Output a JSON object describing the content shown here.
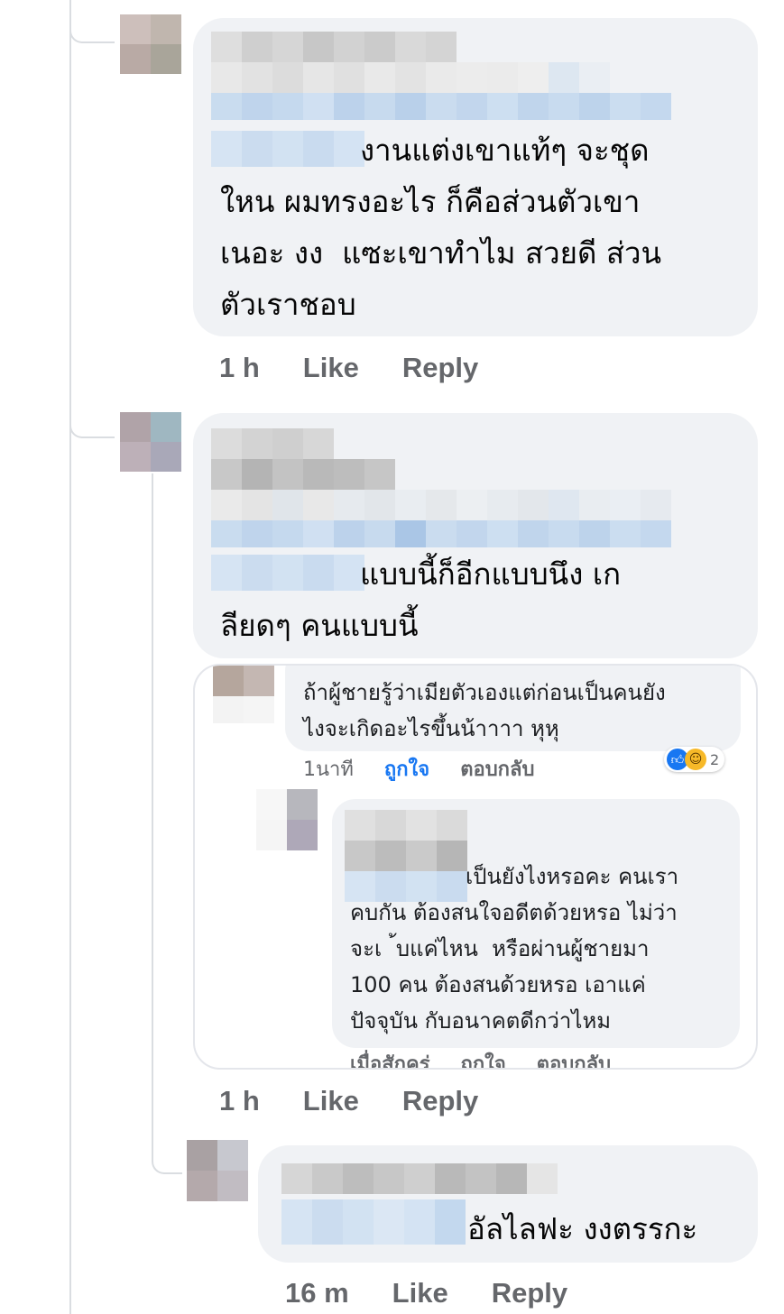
{
  "colors": {
    "bubble": "#f0f2f5",
    "meta_text": "#65676b",
    "thread_line": "#dadde1",
    "link_blue": "#1877f2",
    "blur_gray": [
      "#dcdcdc",
      "#c8c8c8",
      "#b4b4b4",
      "#d0d0d0",
      "#e6e6e6"
    ],
    "blur_blue": [
      "#c9dcef",
      "#b9d0ea",
      "#d6e4f3",
      "#aac6e6"
    ]
  },
  "comments": [
    {
      "text": "งานแต่งเขาแท้ๆ จะชุด\nใหน ผมทรงอะไร ก็คือส่วนตัวเขา\nเนอะ งง  แซะเขาทำไม สวยดี ส่วน\nตัวเราชอบ",
      "time": "1 h",
      "like": "Like",
      "reply": "Reply"
    },
    {
      "text": "แบบนี้ก็อีกแบบนึง เก\nลียดๆ คนแบบนี้",
      "time": "1 h",
      "like": "Like",
      "reply": "Reply",
      "screenshot": {
        "top_comment": {
          "text": "ถ้าผู้ชายรู้ว่าเมียตัวเองแต่ก่อนเป็นคนยัง\nไงจะเกิดอะไรขึ้นน้าาาา หุหุ",
          "time": "1นาที",
          "like": "ถูกใจ",
          "reply": "ตอบกลับ",
          "reaction_icons": [
            "like-reaction-icon",
            "haha-reaction-icon"
          ],
          "reaction_count": "2"
        },
        "reply_comment": {
          "first_line": "เป็นยังไงหรอคะ คนเรา",
          "text": "คบกัน ต้องสนใจอดีตด้วยหรอ ไม่ว่า\nจะเ  ้บแค่ไหน  หรือผ่านผู้ชายมา\n100 คน ต้องสนด้วยหรอ เอาแค่\nปัจจุบัน กับอนาคตดีกว่าไหม",
          "time": "เมื่อสักครู่",
          "like": "ถูกใจ",
          "reply": "ตอบกลับ"
        }
      }
    },
    {
      "text": "อัลไลฟะ งงตรรกะ",
      "time": "16 m",
      "like": "Like",
      "reply": "Reply"
    }
  ]
}
